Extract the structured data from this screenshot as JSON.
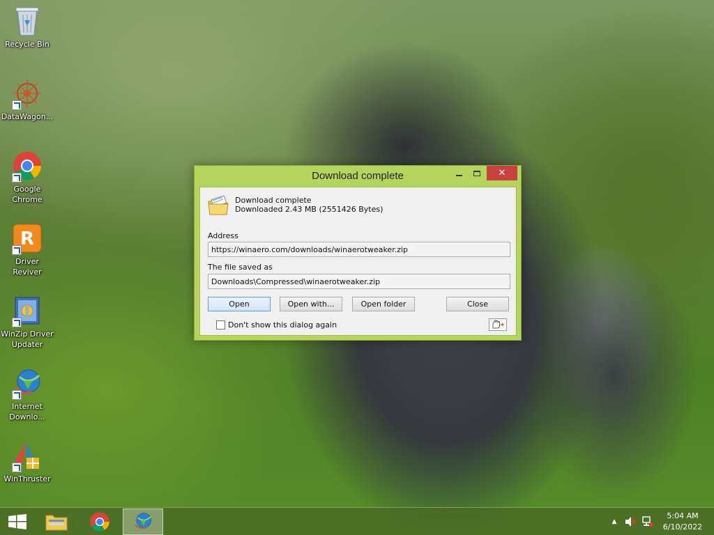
{
  "desktop": {
    "icons": [
      {
        "label": "Recycle Bin"
      },
      {
        "label": "DataWagon..."
      },
      {
        "label": "Google Chrome"
      },
      {
        "label": "Driver Reviver"
      },
      {
        "label": "WinZip Driver Updater"
      },
      {
        "label": "Internet Downlo..."
      },
      {
        "label": "WinThruster"
      }
    ]
  },
  "dialog": {
    "title": "Download complete",
    "heading": "Download complete",
    "downloaded": "Downloaded 2.43  MB (2551426 Bytes)",
    "address_label": "Address",
    "address_value": "https://winaero.com/downloads/winaerotweaker.zip",
    "saved_label": "The file saved as",
    "saved_value": "Downloads\\Compressed\\winaerotweaker.zip",
    "buttons": {
      "open": "Open",
      "open_with": "Open with...",
      "open_folder": "Open folder",
      "close": "Close"
    },
    "dont_show_label": "Don't show this dialog again",
    "dont_show_checked": false
  },
  "taskbar": {
    "clock_time": "5:04 AM",
    "clock_date": "6/10/2022"
  },
  "colors": {
    "dialog_frame": "#b5d45c",
    "close_button": "#c7413f",
    "taskbar": "#486824"
  }
}
